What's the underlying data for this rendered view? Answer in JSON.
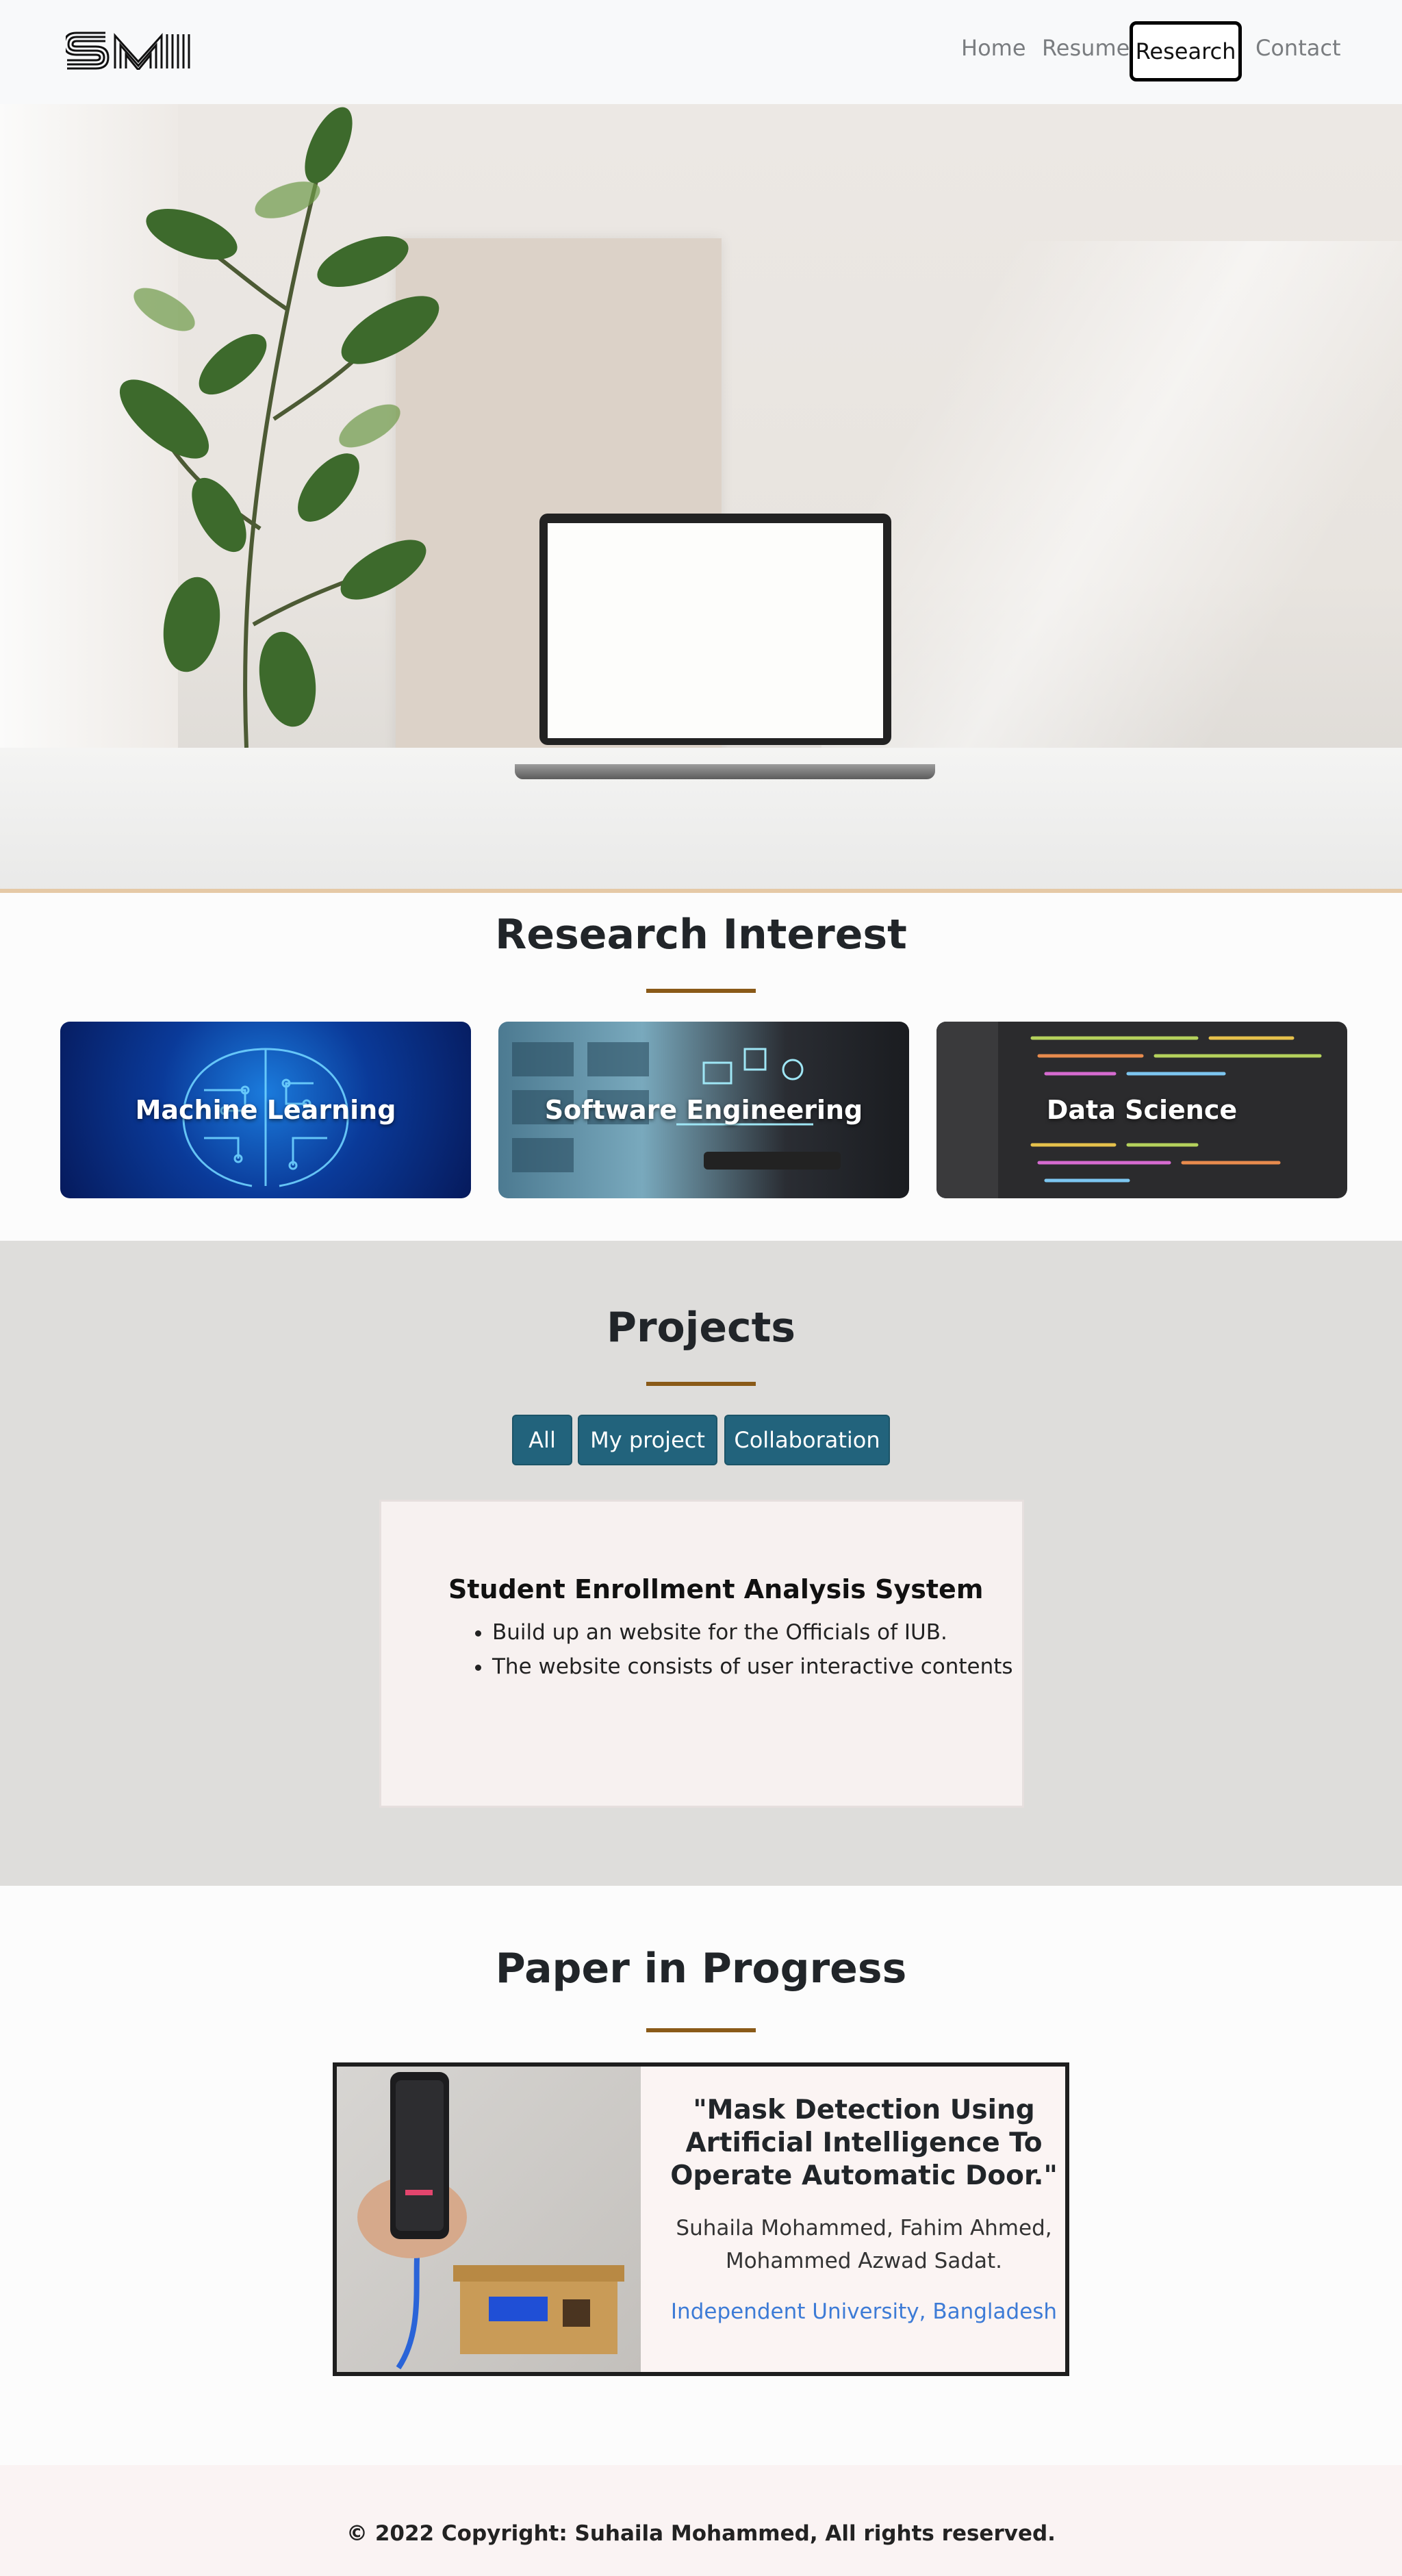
{
  "nav": {
    "logo": "SM",
    "home": "Home",
    "resume": "Resume",
    "research": "Research",
    "contact": "Contact"
  },
  "research_interest": {
    "title": "Research Interest",
    "cards": [
      {
        "label": "Machine Learning"
      },
      {
        "label": "Software Engineering"
      },
      {
        "label": "Data Science"
      }
    ]
  },
  "projects": {
    "title": "Projects",
    "filters": [
      "All",
      "My project",
      "Collaboration"
    ],
    "card": {
      "title": "Student Enrollment Analysis System",
      "bullets": [
        "Build up an website for the Officials of IUB.",
        "The website consists of user interactive contents"
      ]
    }
  },
  "paper": {
    "title": "Paper in Progress",
    "paper_title": "\"Mask Detection Using Artificial Intelligence To Operate Automatic Door.\"",
    "authors": "Suhaila Mohammed, Fahim Ahmed, Mohammed Azwad Sadat.",
    "affiliation": "Independent University, Bangladesh"
  },
  "footer": {
    "text": "© 2022 Copyright: Suhaila Mohammed, All rights reserved."
  },
  "colors": {
    "accent_line": "#8a5a18",
    "button": "#22637c",
    "link": "#3d7bd6"
  }
}
